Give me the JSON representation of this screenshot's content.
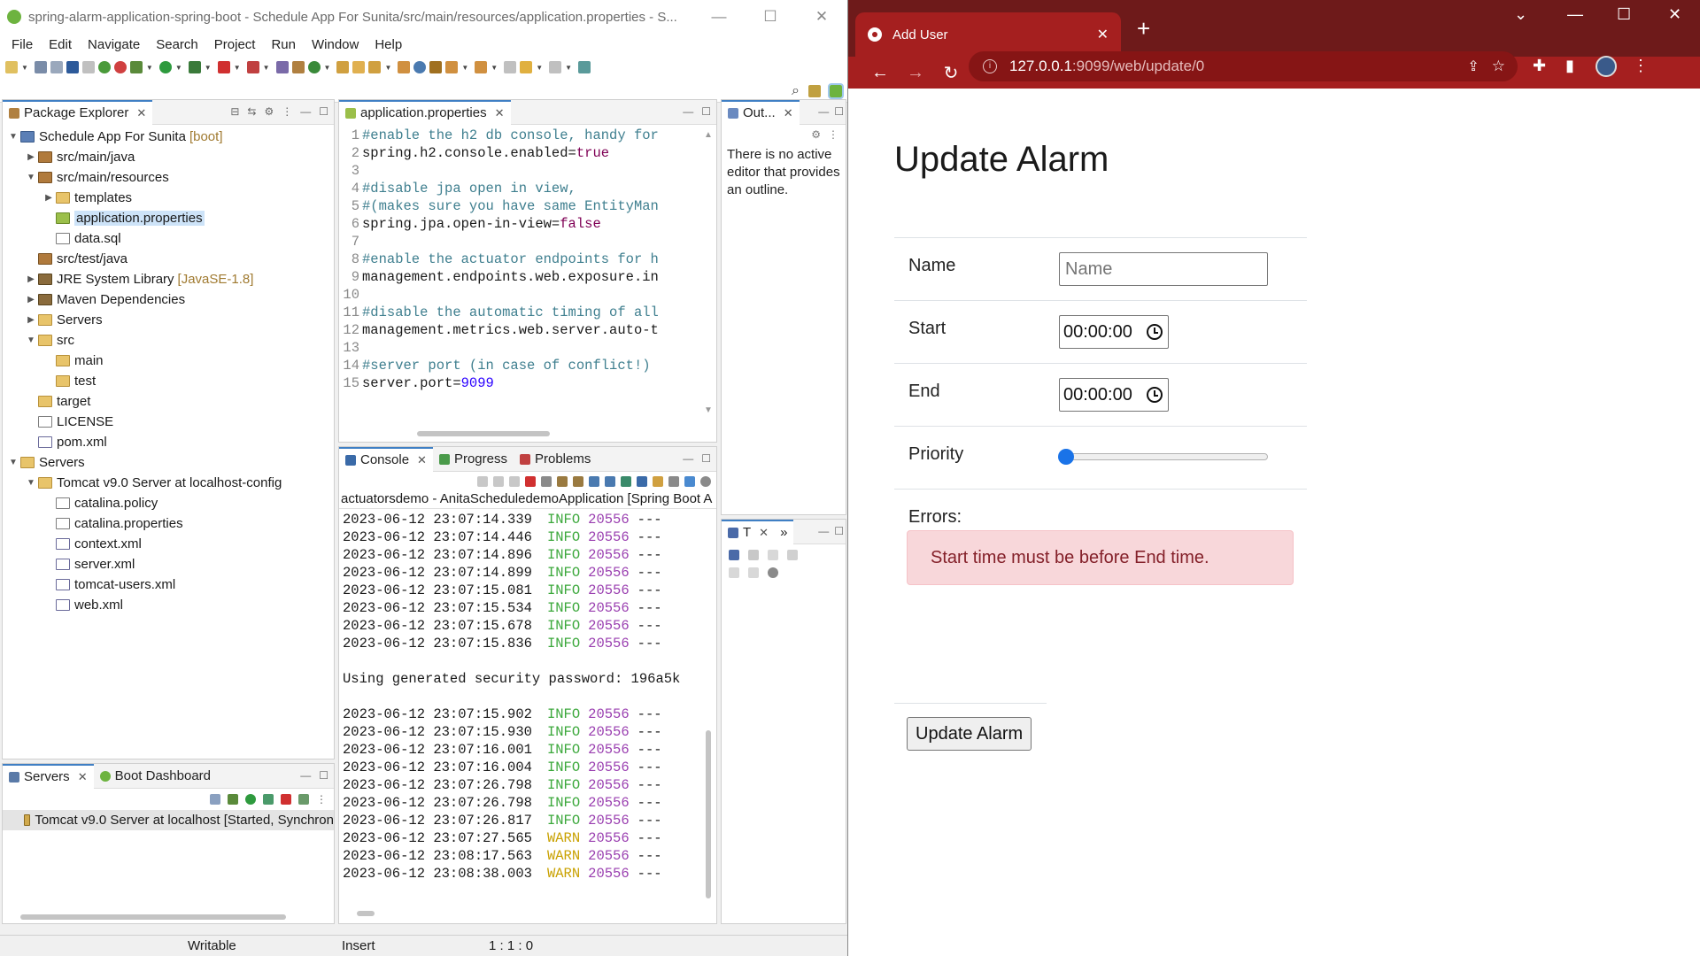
{
  "eclipse": {
    "title": "spring-alarm-application-spring-boot - Schedule App For Sunita/src/main/resources/application.properties - S...",
    "menu": [
      "File",
      "Edit",
      "Navigate",
      "Search",
      "Project",
      "Run",
      "Window",
      "Help"
    ],
    "package_explorer": {
      "tab_label": "Package Explorer",
      "tree": [
        {
          "label": "Schedule App For Sunita",
          "suffix": "[boot]",
          "indent": 0,
          "twisty": "open",
          "icon": "proj"
        },
        {
          "label": "src/main/java",
          "indent": 1,
          "twisty": "closed",
          "icon": "pkg"
        },
        {
          "label": "src/main/resources",
          "indent": 1,
          "twisty": "open",
          "icon": "pkg"
        },
        {
          "label": "templates",
          "indent": 2,
          "twisty": "closed",
          "icon": "folder"
        },
        {
          "label": "application.properties",
          "indent": 2,
          "twisty": "",
          "icon": "props",
          "selected": true
        },
        {
          "label": "data.sql",
          "indent": 2,
          "twisty": "",
          "icon": "file"
        },
        {
          "label": "src/test/java",
          "indent": 1,
          "twisty": "",
          "icon": "pkg"
        },
        {
          "label": "JRE System Library",
          "suffix": "[JavaSE-1.8]",
          "indent": 1,
          "twisty": "closed",
          "icon": "lib"
        },
        {
          "label": "Maven Dependencies",
          "indent": 1,
          "twisty": "closed",
          "icon": "lib"
        },
        {
          "label": "Servers",
          "indent": 1,
          "twisty": "closed",
          "icon": "folder"
        },
        {
          "label": "src",
          "indent": 1,
          "twisty": "open",
          "icon": "folder"
        },
        {
          "label": "main",
          "indent": 2,
          "twisty": "",
          "icon": "folder"
        },
        {
          "label": "test",
          "indent": 2,
          "twisty": "",
          "icon": "folder"
        },
        {
          "label": "target",
          "indent": 1,
          "twisty": "",
          "icon": "folder"
        },
        {
          "label": "LICENSE",
          "indent": 1,
          "twisty": "",
          "icon": "file"
        },
        {
          "label": "pom.xml",
          "indent": 1,
          "twisty": "",
          "icon": "xml"
        },
        {
          "label": "Servers",
          "indent": 0,
          "twisty": "open",
          "icon": "folder"
        },
        {
          "label": "Tomcat v9.0 Server at localhost-config",
          "indent": 1,
          "twisty": "open",
          "icon": "folder"
        },
        {
          "label": "catalina.policy",
          "indent": 2,
          "twisty": "",
          "icon": "file"
        },
        {
          "label": "catalina.properties",
          "indent": 2,
          "twisty": "",
          "icon": "file"
        },
        {
          "label": "context.xml",
          "indent": 2,
          "twisty": "",
          "icon": "xml"
        },
        {
          "label": "server.xml",
          "indent": 2,
          "twisty": "",
          "icon": "xml"
        },
        {
          "label": "tomcat-users.xml",
          "indent": 2,
          "twisty": "",
          "icon": "xml"
        },
        {
          "label": "web.xml",
          "indent": 2,
          "twisty": "",
          "icon": "xml"
        }
      ]
    },
    "servers_view": {
      "tab_servers": "Servers",
      "tab_boot": "Boot Dashboard",
      "server_row": "Tomcat v9.0 Server at localhost  [Started, Synchron"
    },
    "editor": {
      "tab_label": "application.properties",
      "lines": [
        {
          "n": "1",
          "text": "#enable the h2 db console, handy for",
          "kind": "comment"
        },
        {
          "n": "2",
          "key": "spring.h2.console.enabled=",
          "val": "true",
          "kind": "bool"
        },
        {
          "n": "3",
          "text": "",
          "kind": "blank"
        },
        {
          "n": "4",
          "text": "#disable jpa open in view,",
          "kind": "comment"
        },
        {
          "n": "5",
          "text": "#(makes sure you have same EntityMan",
          "kind": "comment"
        },
        {
          "n": "6",
          "key": "spring.jpa.open-in-view=",
          "val": "false",
          "kind": "bool"
        },
        {
          "n": "7",
          "text": "",
          "kind": "blank"
        },
        {
          "n": "8",
          "text": "#enable the actuator endpoints for h",
          "kind": "comment"
        },
        {
          "n": "9",
          "text": "management.endpoints.web.exposure.in",
          "kind": "key"
        },
        {
          "n": "10",
          "text": "",
          "kind": "blank"
        },
        {
          "n": "11",
          "text": "#disable the automatic timing of all",
          "kind": "comment"
        },
        {
          "n": "12",
          "text": "management.metrics.web.server.auto-t",
          "kind": "key"
        },
        {
          "n": "13",
          "text": "",
          "kind": "blank"
        },
        {
          "n": "14",
          "text": "#server port (in case of conflict!)",
          "kind": "comment"
        },
        {
          "n": "15",
          "key": "server.port=",
          "val": "9099",
          "kind": "num"
        }
      ]
    },
    "outline": {
      "tab_label": "Out...",
      "message": "There is no active editor that provides an outline."
    },
    "console": {
      "tab_console": "Console",
      "tab_progress": "Progress",
      "tab_problems": "Problems",
      "header": "actuatorsdemo - AnitaScheduledemoApplication [Spring Boot A",
      "lines": [
        {
          "ts": "2023-06-12 23:07:14.339",
          "level": "INFO",
          "pid": "20556",
          "tail": "---"
        },
        {
          "ts": "2023-06-12 23:07:14.446",
          "level": "INFO",
          "pid": "20556",
          "tail": "---"
        },
        {
          "ts": "2023-06-12 23:07:14.896",
          "level": "INFO",
          "pid": "20556",
          "tail": "---"
        },
        {
          "ts": "2023-06-12 23:07:14.899",
          "level": "INFO",
          "pid": "20556",
          "tail": "---"
        },
        {
          "ts": "2023-06-12 23:07:15.081",
          "level": "INFO",
          "pid": "20556",
          "tail": "---"
        },
        {
          "ts": "2023-06-12 23:07:15.534",
          "level": "INFO",
          "pid": "20556",
          "tail": "---"
        },
        {
          "ts": "2023-06-12 23:07:15.678",
          "level": "INFO",
          "pid": "20556",
          "tail": "---"
        },
        {
          "ts": "2023-06-12 23:07:15.836",
          "level": "INFO",
          "pid": "20556",
          "tail": "---"
        },
        {
          "blank": true
        },
        {
          "plain": "Using generated security password: 196a5k"
        },
        {
          "blank": true
        },
        {
          "ts": "2023-06-12 23:07:15.902",
          "level": "INFO",
          "pid": "20556",
          "tail": "---"
        },
        {
          "ts": "2023-06-12 23:07:15.930",
          "level": "INFO",
          "pid": "20556",
          "tail": "---"
        },
        {
          "ts": "2023-06-12 23:07:16.001",
          "level": "INFO",
          "pid": "20556",
          "tail": "---"
        },
        {
          "ts": "2023-06-12 23:07:16.004",
          "level": "INFO",
          "pid": "20556",
          "tail": "---"
        },
        {
          "ts": "2023-06-12 23:07:26.798",
          "level": "INFO",
          "pid": "20556",
          "tail": "---"
        },
        {
          "ts": "2023-06-12 23:07:26.798",
          "level": "INFO",
          "pid": "20556",
          "tail": "---"
        },
        {
          "ts": "2023-06-12 23:07:26.817",
          "level": "INFO",
          "pid": "20556",
          "tail": "---"
        },
        {
          "ts": "2023-06-12 23:07:27.565",
          "level": "WARN",
          "pid": "20556",
          "tail": "---"
        },
        {
          "ts": "2023-06-12 23:08:17.563",
          "level": "WARN",
          "pid": "20556",
          "tail": "---"
        },
        {
          "ts": "2023-06-12 23:08:38.003",
          "level": "WARN",
          "pid": "20556",
          "tail": "---"
        }
      ]
    },
    "task_view": {
      "tab_label": "T"
    },
    "statusbar": {
      "writable": "Writable",
      "insert": "Insert",
      "position": "1 : 1 : 0"
    }
  },
  "chrome": {
    "tab_title": "Add User",
    "url_host": "127.0.0.1",
    "url_path": ":9099/web/update/0"
  },
  "page": {
    "heading": "Update Alarm",
    "fields": {
      "name_label": "Name",
      "name_placeholder": "Name",
      "start_label": "Start",
      "start_value": "00:00:00",
      "end_label": "End",
      "end_value": "00:00:00",
      "priority_label": "Priority",
      "priority_value": 0
    },
    "errors_label": "Errors:",
    "error_message": "Start time must be before End time.",
    "submit_label": "Update Alarm"
  },
  "colors": {
    "chrome_accent": "#a51f1f",
    "alert_bg": "#f8d7da",
    "alert_text": "#842029",
    "slider_thumb": "#1a73e8"
  }
}
